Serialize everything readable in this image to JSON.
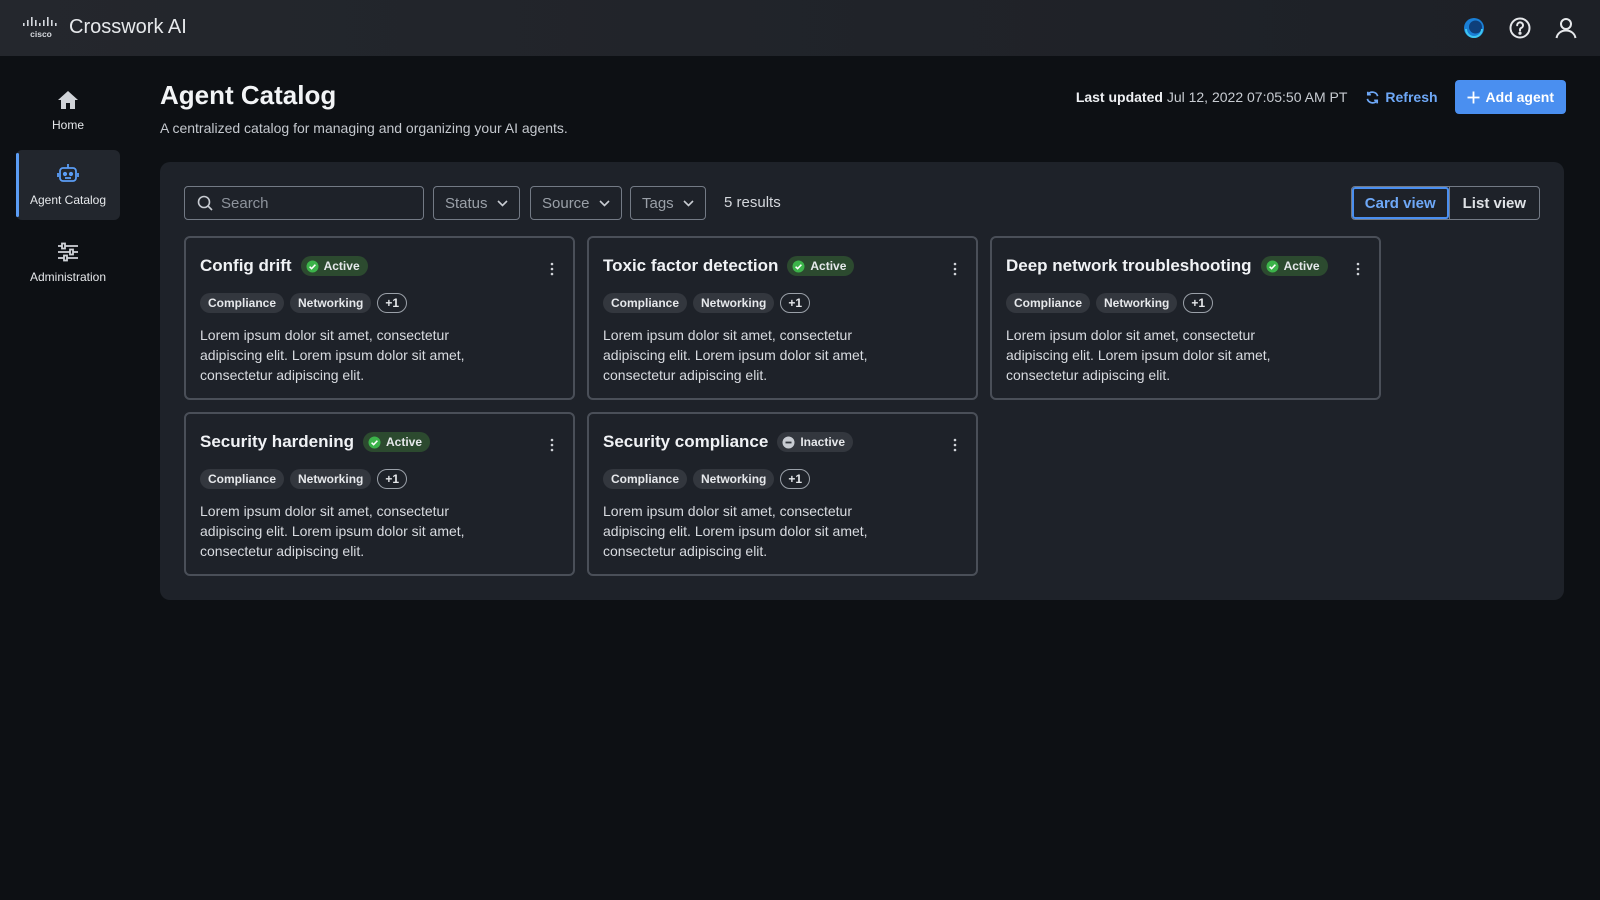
{
  "app": {
    "brand_logo_text": "cisco",
    "title": "Crosswork AI"
  },
  "top_icons": [
    "assistant-icon",
    "help-icon",
    "user-icon"
  ],
  "sidebar": {
    "items": [
      {
        "label": "Home",
        "icon": "home-icon",
        "active": false
      },
      {
        "label": "Agent Catalog",
        "icon": "robot-icon",
        "active": true
      },
      {
        "label": "Administration",
        "icon": "sliders-icon",
        "active": false
      }
    ]
  },
  "header": {
    "title": "Agent Catalog",
    "subtitle": "A centralized catalog for managing and organizing your AI agents.",
    "last_updated_label": "Last updated",
    "last_updated_value": "Jul 12, 2022 07:05:50 AM PT",
    "refresh_label": "Refresh",
    "add_label": "Add agent"
  },
  "toolbar": {
    "search_placeholder": "Search",
    "filters": [
      "Status",
      "Source",
      "Tags"
    ],
    "results": "5 results",
    "views": [
      {
        "label": "Card view",
        "active": true
      },
      {
        "label": "List view",
        "active": false
      }
    ]
  },
  "cards": [
    {
      "title": "Config drift",
      "status": "Active",
      "tags": [
        "Compliance",
        "Networking"
      ],
      "more": "+1",
      "description": "Lorem ipsum dolor sit amet, consectetur adipiscing elit. Lorem ipsum dolor sit amet, consectetur adipiscing elit."
    },
    {
      "title": "Toxic factor detection",
      "status": "Active",
      "tags": [
        "Compliance",
        "Networking"
      ],
      "more": "+1",
      "description": "Lorem ipsum dolor sit amet, consectetur adipiscing elit. Lorem ipsum dolor sit amet, consectetur adipiscing elit."
    },
    {
      "title": "Deep network troubleshooting",
      "status": "Active",
      "tags": [
        "Compliance",
        "Networking"
      ],
      "more": "+1",
      "description": "Lorem ipsum dolor sit amet, consectetur adipiscing elit. Lorem ipsum dolor sit amet, consectetur adipiscing elit."
    },
    {
      "title": "Security hardening",
      "status": "Active",
      "tags": [
        "Compliance",
        "Networking"
      ],
      "more": "+1",
      "description": "Lorem ipsum dolor sit amet, consectetur adipiscing elit. Lorem ipsum dolor sit amet, consectetur adipiscing elit."
    },
    {
      "title": "Security compliance",
      "status": "Inactive",
      "tags": [
        "Compliance",
        "Networking"
      ],
      "more": "+1",
      "description": "Lorem ipsum dolor sit amet, consectetur adipiscing elit. Lorem ipsum dolor sit amet, consectetur adipiscing elit."
    }
  ],
  "colors": {
    "accent": "#4a8ff0",
    "active_status": "#3cb34a",
    "inactive_status": "#9aa0a8"
  }
}
